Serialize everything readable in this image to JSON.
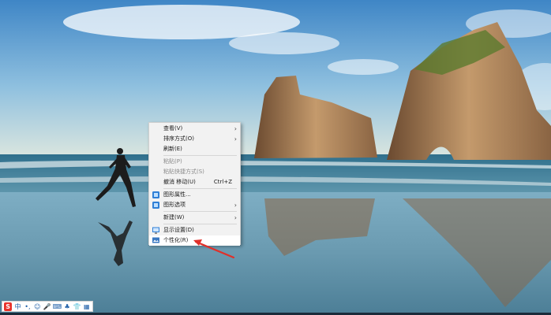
{
  "menu": {
    "items": [
      {
        "label": "查看(V)",
        "submenu": true
      },
      {
        "label": "排序方式(O)",
        "submenu": true
      },
      {
        "label": "刷新(E)"
      },
      {
        "label": "粘贴(P)",
        "disabled": true
      },
      {
        "label": "粘贴快捷方式(S)",
        "disabled": true
      },
      {
        "label": "撤消 移动(U)",
        "shortcut": "Ctrl+Z"
      },
      {
        "label": "图形属性...",
        "icon": "graphics-icon"
      },
      {
        "label": "图形选项",
        "icon": "graphics-icon",
        "submenu": true
      },
      {
        "label": "新建(W)",
        "submenu": true
      },
      {
        "label": "显示设置(D)",
        "icon": "display-icon"
      },
      {
        "label": "个性化(R)",
        "icon": "personalize-icon"
      }
    ],
    "arrow_glyph": "›"
  },
  "tray": {
    "ime_logo": "S",
    "items": [
      "中",
      "•,",
      "☺",
      "🎤",
      "⌨",
      "♣",
      "👕",
      "▦"
    ]
  },
  "colors": {
    "annotation_arrow": "#e0302a",
    "menu_bg": "#f2f2f2"
  }
}
